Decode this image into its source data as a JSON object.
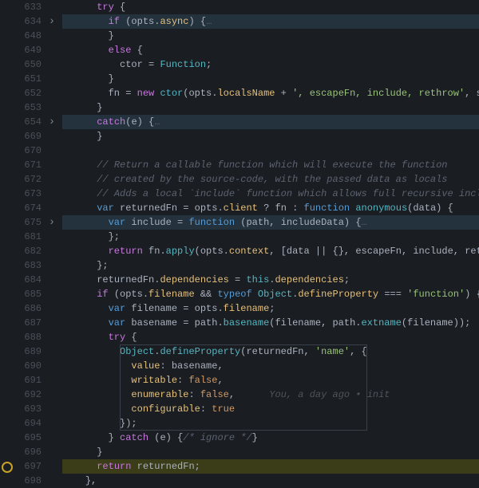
{
  "lines": [
    {
      "n": 633,
      "fold": false,
      "hl": "",
      "tokens": [
        [
          "",
          "      "
        ],
        [
          "ctrl",
          "try"
        ],
        [
          "pn",
          " {"
        ]
      ]
    },
    {
      "n": 634,
      "fold": true,
      "hl": "hl",
      "tokens": [
        [
          "",
          "        "
        ],
        [
          "ctrl",
          "if"
        ],
        [
          "pn",
          " ("
        ],
        [
          "var",
          "opts"
        ],
        [
          "op",
          "."
        ],
        [
          "prop",
          "async"
        ],
        [
          "pn",
          ") "
        ],
        [
          "pn",
          "{"
        ],
        [
          "collapsed-dots",
          "…"
        ]
      ]
    },
    {
      "n": 648,
      "fold": false,
      "hl": "",
      "tokens": [
        [
          "",
          "        "
        ],
        [
          "pn",
          "}"
        ]
      ]
    },
    {
      "n": 649,
      "fold": false,
      "hl": "",
      "tokens": [
        [
          "",
          "        "
        ],
        [
          "ctrl",
          "else"
        ],
        [
          "pn",
          " {"
        ]
      ]
    },
    {
      "n": 650,
      "fold": false,
      "hl": "",
      "tokens": [
        [
          "",
          "          "
        ],
        [
          "var",
          "ctor"
        ],
        [
          "op",
          " = "
        ],
        [
          "type",
          "Function"
        ],
        [
          "pn",
          ";"
        ]
      ]
    },
    {
      "n": 651,
      "fold": false,
      "hl": "",
      "tokens": [
        [
          "",
          "        "
        ],
        [
          "pn",
          "}"
        ]
      ]
    },
    {
      "n": 652,
      "fold": false,
      "hl": "",
      "tokens": [
        [
          "",
          "        "
        ],
        [
          "var",
          "fn"
        ],
        [
          "op",
          " = "
        ],
        [
          "new",
          "new"
        ],
        [
          "op",
          " "
        ],
        [
          "fn",
          "ctor"
        ],
        [
          "pn",
          "("
        ],
        [
          "var",
          "opts"
        ],
        [
          "op",
          "."
        ],
        [
          "prop",
          "localsName"
        ],
        [
          "op",
          " + "
        ],
        [
          "str",
          "', escapeFn, include, rethrow'"
        ],
        [
          "pn",
          ", "
        ],
        [
          "var",
          "src"
        ],
        [
          "pn",
          ");"
        ]
      ]
    },
    {
      "n": 653,
      "fold": false,
      "hl": "",
      "tokens": [
        [
          "",
          "      "
        ],
        [
          "pn",
          "}"
        ]
      ]
    },
    {
      "n": 654,
      "fold": true,
      "hl": "hl",
      "tokens": [
        [
          "",
          "      "
        ],
        [
          "ctrl",
          "catch"
        ],
        [
          "pn",
          "("
        ],
        [
          "var",
          "e"
        ],
        [
          "pn",
          ") "
        ],
        [
          "pn",
          "{"
        ],
        [
          "collapsed-dots",
          "…"
        ]
      ]
    },
    {
      "n": 669,
      "fold": false,
      "hl": "",
      "tokens": [
        [
          "",
          "      "
        ],
        [
          "pn",
          "}"
        ]
      ]
    },
    {
      "n": 670,
      "fold": false,
      "hl": "",
      "tokens": [
        [
          "",
          ""
        ]
      ]
    },
    {
      "n": 671,
      "fold": false,
      "hl": "",
      "tokens": [
        [
          "",
          "      "
        ],
        [
          "cmt",
          "// Return a callable function which will execute the function"
        ]
      ]
    },
    {
      "n": 672,
      "fold": false,
      "hl": "",
      "tokens": [
        [
          "",
          "      "
        ],
        [
          "cmt",
          "// created by the source-code, with the passed data as locals"
        ]
      ]
    },
    {
      "n": 673,
      "fold": false,
      "hl": "",
      "tokens": [
        [
          "",
          "      "
        ],
        [
          "cmt",
          "// Adds a local `include` function which allows full recursive include"
        ]
      ]
    },
    {
      "n": 674,
      "fold": false,
      "hl": "",
      "tokens": [
        [
          "",
          "      "
        ],
        [
          "kw2",
          "var"
        ],
        [
          "op",
          " "
        ],
        [
          "var",
          "returnedFn"
        ],
        [
          "op",
          " = "
        ],
        [
          "var",
          "opts"
        ],
        [
          "op",
          "."
        ],
        [
          "prop",
          "client"
        ],
        [
          "op",
          " ? "
        ],
        [
          "var",
          "fn"
        ],
        [
          "op",
          " : "
        ],
        [
          "kw2",
          "function"
        ],
        [
          "op",
          " "
        ],
        [
          "fn",
          "anonymous"
        ],
        [
          "pn",
          "("
        ],
        [
          "var",
          "data"
        ],
        [
          "pn",
          ") {"
        ]
      ]
    },
    {
      "n": 675,
      "fold": true,
      "hl": "hl",
      "tokens": [
        [
          "",
          "        "
        ],
        [
          "kw2",
          "var"
        ],
        [
          "op",
          " "
        ],
        [
          "var",
          "include"
        ],
        [
          "op",
          " = "
        ],
        [
          "kw2",
          "function"
        ],
        [
          "pn",
          " ("
        ],
        [
          "var",
          "path"
        ],
        [
          "pn",
          ", "
        ],
        [
          "var",
          "includeData"
        ],
        [
          "pn",
          ") "
        ],
        [
          "pn",
          "{"
        ],
        [
          "collapsed-dots",
          "…"
        ]
      ]
    },
    {
      "n": 681,
      "fold": false,
      "hl": "",
      "tokens": [
        [
          "",
          "        "
        ],
        [
          "pn",
          "};"
        ]
      ]
    },
    {
      "n": 682,
      "fold": false,
      "hl": "",
      "tokens": [
        [
          "",
          "        "
        ],
        [
          "ctrl",
          "return"
        ],
        [
          "op",
          " "
        ],
        [
          "var",
          "fn"
        ],
        [
          "op",
          "."
        ],
        [
          "fn",
          "apply"
        ],
        [
          "pn",
          "("
        ],
        [
          "var",
          "opts"
        ],
        [
          "op",
          "."
        ],
        [
          "prop",
          "context"
        ],
        [
          "pn",
          ", ["
        ],
        [
          "var",
          "data"
        ],
        [
          "op",
          " || "
        ],
        [
          "pn",
          "{}, "
        ],
        [
          "var",
          "escapeFn"
        ],
        [
          "pn",
          ", "
        ],
        [
          "var",
          "include"
        ],
        [
          "pn",
          ", "
        ],
        [
          "var",
          "rethrow"
        ],
        [
          "pn",
          "]);"
        ]
      ]
    },
    {
      "n": 683,
      "fold": false,
      "hl": "",
      "tokens": [
        [
          "",
          "      "
        ],
        [
          "pn",
          "};"
        ]
      ]
    },
    {
      "n": 684,
      "fold": false,
      "hl": "",
      "tokens": [
        [
          "",
          "      "
        ],
        [
          "var",
          "returnedFn"
        ],
        [
          "op",
          "."
        ],
        [
          "prop",
          "dependencies"
        ],
        [
          "op",
          " = "
        ],
        [
          "this",
          "this"
        ],
        [
          "op",
          "."
        ],
        [
          "prop",
          "dependencies"
        ],
        [
          "pn",
          ";"
        ]
      ]
    },
    {
      "n": 685,
      "fold": false,
      "hl": "",
      "tokens": [
        [
          "",
          "      "
        ],
        [
          "ctrl",
          "if"
        ],
        [
          "pn",
          " ("
        ],
        [
          "var",
          "opts"
        ],
        [
          "op",
          "."
        ],
        [
          "prop",
          "filename"
        ],
        [
          "op",
          " && "
        ],
        [
          "kw2",
          "typeof"
        ],
        [
          "op",
          " "
        ],
        [
          "type",
          "Object"
        ],
        [
          "op",
          "."
        ],
        [
          "prop",
          "defineProperty"
        ],
        [
          "op",
          " === "
        ],
        [
          "str",
          "'function'"
        ],
        [
          "pn",
          ") {"
        ]
      ]
    },
    {
      "n": 686,
      "fold": false,
      "hl": "",
      "tokens": [
        [
          "",
          "        "
        ],
        [
          "kw2",
          "var"
        ],
        [
          "op",
          " "
        ],
        [
          "var",
          "filename"
        ],
        [
          "op",
          " = "
        ],
        [
          "var",
          "opts"
        ],
        [
          "op",
          "."
        ],
        [
          "prop",
          "filename"
        ],
        [
          "pn",
          ";"
        ]
      ]
    },
    {
      "n": 687,
      "fold": false,
      "hl": "",
      "tokens": [
        [
          "",
          "        "
        ],
        [
          "kw2",
          "var"
        ],
        [
          "op",
          " "
        ],
        [
          "var",
          "basename"
        ],
        [
          "op",
          " = "
        ],
        [
          "var",
          "path"
        ],
        [
          "op",
          "."
        ],
        [
          "fn",
          "basename"
        ],
        [
          "pn",
          "("
        ],
        [
          "var",
          "filename"
        ],
        [
          "pn",
          ", "
        ],
        [
          "var",
          "path"
        ],
        [
          "op",
          "."
        ],
        [
          "fn",
          "extname"
        ],
        [
          "pn",
          "("
        ],
        [
          "var",
          "filename"
        ],
        [
          "pn",
          "));"
        ]
      ]
    },
    {
      "n": 688,
      "fold": false,
      "hl": "",
      "tokens": [
        [
          "",
          "        "
        ],
        [
          "ctrl",
          "try"
        ],
        [
          "pn",
          " {"
        ]
      ]
    },
    {
      "n": 689,
      "fold": false,
      "hl": "",
      "tokens": [
        [
          "",
          "          "
        ],
        [
          "type",
          "Object"
        ],
        [
          "op",
          "."
        ],
        [
          "fn",
          "defineProperty"
        ],
        [
          "pn",
          "("
        ],
        [
          "var",
          "returnedFn"
        ],
        [
          "pn",
          ", "
        ],
        [
          "str",
          "'name'"
        ],
        [
          "pn",
          ", "
        ],
        [
          "pn",
          "{"
        ]
      ]
    },
    {
      "n": 690,
      "fold": false,
      "hl": "",
      "tokens": [
        [
          "",
          "            "
        ],
        [
          "prop",
          "value"
        ],
        [
          "pn",
          ": "
        ],
        [
          "var",
          "basename"
        ],
        [
          "pn",
          ","
        ]
      ]
    },
    {
      "n": 691,
      "fold": false,
      "hl": "",
      "tokens": [
        [
          "",
          "            "
        ],
        [
          "prop",
          "writable"
        ],
        [
          "pn",
          ": "
        ],
        [
          "bool",
          "false"
        ],
        [
          "pn",
          ","
        ]
      ]
    },
    {
      "n": 692,
      "fold": false,
      "hl": "",
      "tokens": [
        [
          "",
          "            "
        ],
        [
          "prop",
          "enumerable"
        ],
        [
          "pn",
          ": "
        ],
        [
          "bool",
          "false"
        ],
        [
          "pn",
          ",      "
        ],
        [
          "blame",
          "You, a day ago • init"
        ]
      ]
    },
    {
      "n": 693,
      "fold": false,
      "hl": "",
      "tokens": [
        [
          "",
          "            "
        ],
        [
          "prop",
          "configurable"
        ],
        [
          "pn",
          ": "
        ],
        [
          "bool",
          "true"
        ]
      ]
    },
    {
      "n": 694,
      "fold": false,
      "hl": "",
      "tokens": [
        [
          "",
          "          "
        ],
        [
          "pn",
          "});"
        ]
      ]
    },
    {
      "n": 695,
      "fold": false,
      "hl": "",
      "tokens": [
        [
          "",
          "        "
        ],
        [
          "pn",
          "} "
        ],
        [
          "ctrl",
          "catch"
        ],
        [
          "pn",
          " ("
        ],
        [
          "var",
          "e"
        ],
        [
          "pn",
          ") {"
        ],
        [
          "cmt",
          "/* ignore */"
        ],
        [
          "pn",
          "}"
        ]
      ]
    },
    {
      "n": 696,
      "fold": false,
      "hl": "",
      "tokens": [
        [
          "",
          "      "
        ],
        [
          "pn",
          "}"
        ]
      ]
    },
    {
      "n": 697,
      "fold": false,
      "hl": "hl-strong",
      "pause": true,
      "tokens": [
        [
          "",
          "      "
        ],
        [
          "ctrl",
          "return"
        ],
        [
          "op",
          " "
        ],
        [
          "var",
          "returnedFn"
        ],
        [
          "pn",
          ";"
        ]
      ]
    },
    {
      "n": 698,
      "fold": false,
      "hl": "",
      "tokens": [
        [
          "",
          "    "
        ],
        [
          "pn",
          "},"
        ]
      ]
    }
  ],
  "bracket_box": {
    "top_line": 689,
    "bottom_line": 694,
    "left_ch": 10,
    "right_ch": 53
  },
  "blame_text": "You, a day ago • init"
}
